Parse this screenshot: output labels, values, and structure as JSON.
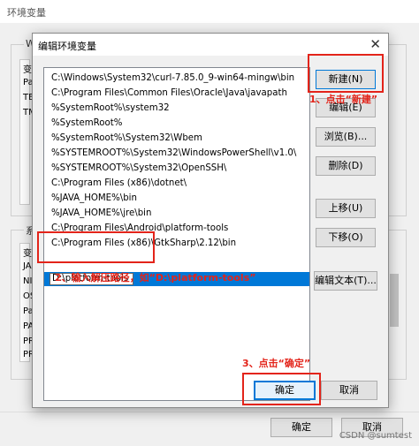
{
  "background_window": {
    "title": "环境变量",
    "user_group_label": "W90",
    "system_group_label": "系统",
    "user_rows": [
      "变",
      "Pa",
      "TE",
      "TM"
    ],
    "system_rows": [
      "变",
      "JA",
      "NI",
      "OS",
      "Pa",
      "PA",
      "PR",
      "PR"
    ],
    "ok": "确定",
    "cancel": "取消",
    "watermark": "CSDN @sumtest"
  },
  "dialog": {
    "title": "编辑环境变量",
    "close_glyph": "✕",
    "paths": [
      "C:\\Windows\\System32\\curl-7.85.0_9-win64-mingw\\bin",
      "C:\\Program Files\\Common Files\\Oracle\\Java\\javapath",
      "%SystemRoot%\\system32",
      "%SystemRoot%",
      "%SystemRoot%\\System32\\Wbem",
      "%SYSTEMROOT%\\System32\\WindowsPowerShell\\v1.0\\",
      "%SYSTEMROOT%\\System32\\OpenSSH\\",
      "C:\\Program Files (x86)\\dotnet\\",
      "%JAVA_HOME%\\bin",
      "%JAVA_HOME%\\jre\\bin",
      "C:\\Program Files\\Android\\platform-tools",
      "C:\\Program Files (x86)\\GtkSharp\\2.12\\bin"
    ],
    "editing_value": "D:\\platform-tools",
    "buttons": {
      "new": "新建(N)",
      "edit": "编辑(E)",
      "browse": "浏览(B)...",
      "delete": "删除(D)",
      "move_up": "上移(U)",
      "move_down": "下移(O)",
      "edit_text": "编辑文本(T)...",
      "ok": "确定",
      "cancel": "取消"
    }
  },
  "annotations": {
    "step1": "1、点击“新建”",
    "step2": "2、输入解压路径，如“D:\\platform-tools”",
    "step3": "3、点击“确定”",
    "color": "#e3241a"
  },
  "colors": {
    "selection": "#0078d7",
    "accent_border": "#0078d7"
  }
}
